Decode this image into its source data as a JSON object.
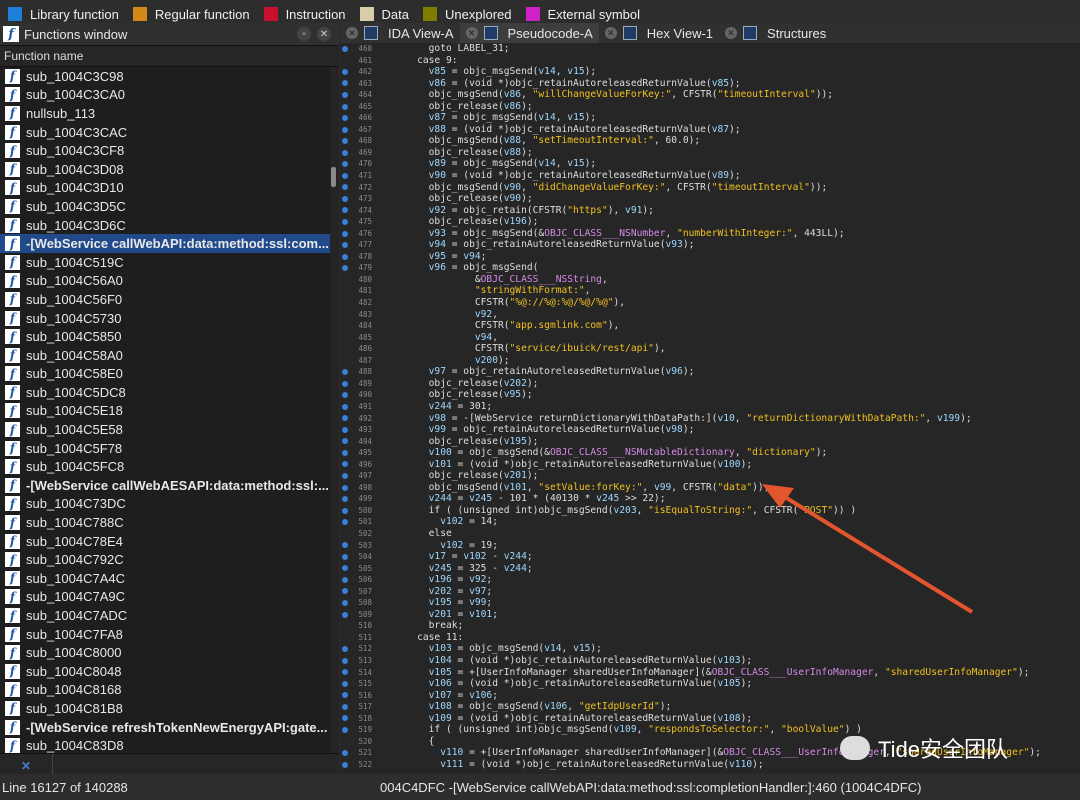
{
  "legend": [
    {
      "label": "Library function",
      "color": "#1f7fd8"
    },
    {
      "label": "Regular function",
      "color": "#d4881a"
    },
    {
      "label": "Instruction",
      "color": "#c8102e"
    },
    {
      "label": "Data",
      "color": "#d8ceaa"
    },
    {
      "label": "Unexplored",
      "color": "#7d7d00"
    },
    {
      "label": "External symbol",
      "color": "#d020c8"
    }
  ],
  "functions_window": {
    "title": "Functions window",
    "column_header": "Function name",
    "items": [
      {
        "name": "sub_1004C3C98"
      },
      {
        "name": "sub_1004C3CA0"
      },
      {
        "name": "nullsub_113"
      },
      {
        "name": "sub_1004C3CAC"
      },
      {
        "name": "sub_1004C3CF8"
      },
      {
        "name": "sub_1004C3D08"
      },
      {
        "name": "sub_1004C3D10"
      },
      {
        "name": "sub_1004C3D5C"
      },
      {
        "name": "sub_1004C3D6C"
      },
      {
        "name": "-[WebService callWebAPI:data:method:ssl:com...",
        "bold": true,
        "selected": true
      },
      {
        "name": "sub_1004C519C"
      },
      {
        "name": "sub_1004C56A0"
      },
      {
        "name": "sub_1004C56F0"
      },
      {
        "name": "sub_1004C5730"
      },
      {
        "name": "sub_1004C5850"
      },
      {
        "name": "sub_1004C58A0"
      },
      {
        "name": "sub_1004C58E0"
      },
      {
        "name": "sub_1004C5DC8"
      },
      {
        "name": "sub_1004C5E18"
      },
      {
        "name": "sub_1004C5E58"
      },
      {
        "name": "sub_1004C5F78"
      },
      {
        "name": "sub_1004C5FC8"
      },
      {
        "name": "-[WebService callWebAESAPI:data:method:ssl:...",
        "bold": true
      },
      {
        "name": "sub_1004C73DC"
      },
      {
        "name": "sub_1004C788C"
      },
      {
        "name": "sub_1004C78E4"
      },
      {
        "name": "sub_1004C792C"
      },
      {
        "name": "sub_1004C7A4C"
      },
      {
        "name": "sub_1004C7A9C"
      },
      {
        "name": "sub_1004C7ADC"
      },
      {
        "name": "sub_1004C7FA8"
      },
      {
        "name": "sub_1004C8000"
      },
      {
        "name": "sub_1004C8048"
      },
      {
        "name": "sub_1004C8168"
      },
      {
        "name": "sub_1004C81B8"
      },
      {
        "name": "-[WebService refreshTokenNewEnergyAPI:gate...",
        "bold": true
      },
      {
        "name": "sub_1004C83D8"
      }
    ],
    "line_status": "Line 16127 of 140288"
  },
  "tabs": [
    {
      "label": "IDA View-A"
    },
    {
      "label": "Pseudocode-A",
      "active": true
    },
    {
      "label": "Hex View-1"
    },
    {
      "label": "Structures"
    }
  ],
  "code_lines": [
    {
      "n": "460",
      "t": "      goto LABEL_31;"
    },
    {
      "n": "461",
      "t": "    case 9:"
    },
    {
      "n": "462",
      "t": "      v85 = objc_msgSend(v14, v15);"
    },
    {
      "n": "463",
      "t": "      v86 = (void *)objc_retainAutoreleasedReturnValue(v85);"
    },
    {
      "n": "464",
      "t": "      objc_msgSend(v86, \"willChangeValueForKey:\", CFSTR(\"timeoutInterval\"));"
    },
    {
      "n": "465",
      "t": "      objc_release(v86);"
    },
    {
      "n": "466",
      "t": "      v87 = objc_msgSend(v14, v15);"
    },
    {
      "n": "467",
      "t": "      v88 = (void *)objc_retainAutoreleasedReturnValue(v87);"
    },
    {
      "n": "468",
      "t": "      objc_msgSend(v88, \"setTimeoutInterval:\", 60.0);"
    },
    {
      "n": "469",
      "t": "      objc_release(v88);"
    },
    {
      "n": "470",
      "t": "      v89 = objc_msgSend(v14, v15);"
    },
    {
      "n": "471",
      "t": "      v90 = (void *)objc_retainAutoreleasedReturnValue(v89);"
    },
    {
      "n": "472",
      "t": "      objc_msgSend(v90, \"didChangeValueForKey:\", CFSTR(\"timeoutInterval\"));"
    },
    {
      "n": "473",
      "t": "      objc_release(v90);"
    },
    {
      "n": "474",
      "t": "      v92 = objc_retain(CFSTR(\"https\"), v91);"
    },
    {
      "n": "475",
      "t": "      objc_release(v196);"
    },
    {
      "n": "476",
      "t": "      v93 = objc_msgSend(&OBJC_CLASS___NSNumber, \"numberWithInteger:\", 443LL);"
    },
    {
      "n": "477",
      "t": "      v94 = objc_retainAutoreleasedReturnValue(v93);"
    },
    {
      "n": "478",
      "t": "      v95 = v94;"
    },
    {
      "n": "479",
      "t": "      v96 = objc_msgSend("
    },
    {
      "n": "480",
      "t": "              &OBJC_CLASS___NSString,"
    },
    {
      "n": "481",
      "t": "              \"stringWithFormat:\","
    },
    {
      "n": "482",
      "t": "              CFSTR(\"%@://%@:%@/%@/%@\"),"
    },
    {
      "n": "483",
      "t": "              v92,"
    },
    {
      "n": "484",
      "t": "              CFSTR(\"app.sgmlink.com\"),"
    },
    {
      "n": "485",
      "t": "              v94,"
    },
    {
      "n": "486",
      "t": "              CFSTR(\"service/ibuick/rest/api\"),"
    },
    {
      "n": "487",
      "t": "              v200);"
    },
    {
      "n": "488",
      "t": "      v97 = objc_retainAutoreleasedReturnValue(v96);"
    },
    {
      "n": "489",
      "t": "      objc_release(v202);"
    },
    {
      "n": "490",
      "t": "      objc_release(v95);"
    },
    {
      "n": "491",
      "t": "      v244 = 301;"
    },
    {
      "n": "492",
      "t": "      v98 = -[WebService returnDictionaryWithDataPath:](v10, \"returnDictionaryWithDataPath:\", v199);"
    },
    {
      "n": "493",
      "t": "      v99 = objc_retainAutoreleasedReturnValue(v98);"
    },
    {
      "n": "494",
      "t": "      objc_release(v195);"
    },
    {
      "n": "495",
      "t": "      v100 = objc_msgSend(&OBJC_CLASS___NSMutableDictionary, \"dictionary\");"
    },
    {
      "n": "496",
      "t": "      v101 = (void *)objc_retainAutoreleasedReturnValue(v100);"
    },
    {
      "n": "497",
      "t": "      objc_release(v201);"
    },
    {
      "n": "498",
      "t": "      objc_msgSend(v101, \"setValue:forKey:\", v99, CFSTR(\"data\"));"
    },
    {
      "n": "499",
      "t": "      v244 = v245 - 101 * (40130 * v245 >> 22);"
    },
    {
      "n": "500",
      "t": "      if ( (unsigned int)objc_msgSend(v203, \"isEqualToString:\", CFSTR(\"POST\")) )"
    },
    {
      "n": "501",
      "t": "        v102 = 14;"
    },
    {
      "n": "502",
      "t": "      else"
    },
    {
      "n": "503",
      "t": "        v102 = 19;"
    },
    {
      "n": "504",
      "t": "      v17 = v102 - v244;"
    },
    {
      "n": "505",
      "t": "      v245 = 325 - v244;"
    },
    {
      "n": "506",
      "t": "      v196 = v92;"
    },
    {
      "n": "507",
      "t": "      v202 = v97;"
    },
    {
      "n": "508",
      "t": "      v195 = v99;"
    },
    {
      "n": "509",
      "t": "      v201 = v101;"
    },
    {
      "n": "510",
      "t": "      break;"
    },
    {
      "n": "511",
      "t": "    case 11:"
    },
    {
      "n": "512",
      "t": "      v103 = objc_msgSend(v14, v15);"
    },
    {
      "n": "513",
      "t": "      v104 = (void *)objc_retainAutoreleasedReturnValue(v103);"
    },
    {
      "n": "514",
      "t": "      v105 = +[UserInfoManager sharedUserInfoManager](&OBJC_CLASS___UserInfoManager, \"sharedUserInfoManager\");"
    },
    {
      "n": "515",
      "t": "      v106 = (void *)objc_retainAutoreleasedReturnValue(v105);"
    },
    {
      "n": "516",
      "t": "      v107 = v106;"
    },
    {
      "n": "517",
      "t": "      v108 = objc_msgSend(v106, \"getIdpUserId\");"
    },
    {
      "n": "518",
      "t": "      v109 = (void *)objc_retainAutoreleasedReturnValue(v108);"
    },
    {
      "n": "519",
      "t": "      if ( (unsigned int)objc_msgSend(v109, \"respondsToSelector:\", \"boolValue\") )"
    },
    {
      "n": "520",
      "t": "      {"
    },
    {
      "n": "521",
      "t": "        v110 = +[UserInfoManager sharedUserInfoManager](&OBJC_CLASS___UserInfoManager, \"sharedUserInfoManager\");"
    },
    {
      "n": "522",
      "t": "        v111 = (void *)objc_retainAutoreleasedReturnValue(v110);"
    }
  ],
  "status_bar": {
    "address": "004C4DFC  -[WebService callWebAPI:data:method:ssl:completionHandler:]:460 (1004C4DFC)"
  },
  "watermark": "Tide安全团队"
}
